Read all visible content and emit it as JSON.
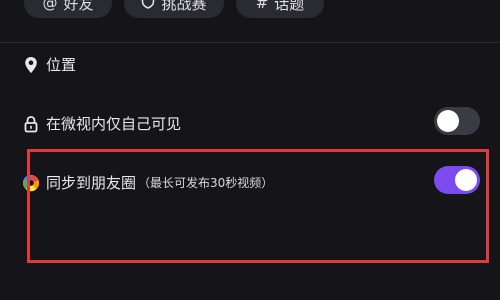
{
  "tags": [
    {
      "label": "好友",
      "glyph": "@",
      "icon": "at-icon"
    },
    {
      "label": "挑战赛",
      "glyph": "",
      "icon": "shield-icon"
    },
    {
      "label": "话题",
      "glyph": "#",
      "icon": "hash-icon"
    }
  ],
  "settings": {
    "location_label": "位置",
    "private_label": "在微视内仅自己可见",
    "private_enabled": false,
    "sync_label": "同步到朋友圈",
    "sync_hint": "（最长可发布30秒视频）",
    "sync_enabled": true
  },
  "colors": {
    "background": "#141419",
    "toggle_on": "#7c4bef",
    "toggle_off": "#3b3b43",
    "highlight_border": "#e23a3a"
  }
}
